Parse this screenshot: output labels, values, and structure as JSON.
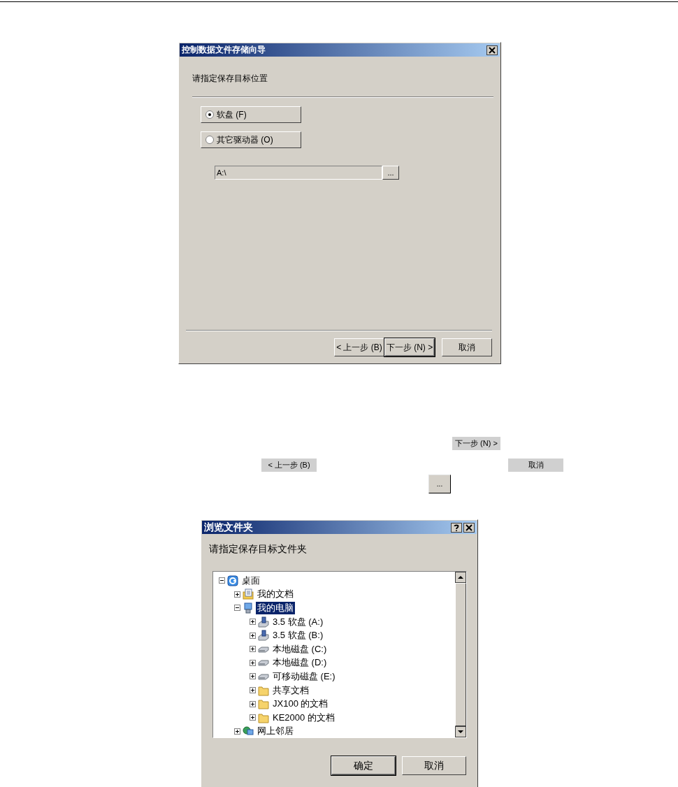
{
  "wizard": {
    "title": "控制数据文件存储向导",
    "prompt": "请指定保存目标位置",
    "options": [
      {
        "label": "软盘 (F)",
        "selected": true
      },
      {
        "label": "其它驱动器 (O)",
        "selected": false
      }
    ],
    "path": {
      "value": "A:\\",
      "disabled": true
    },
    "browse_button": "...",
    "buttons": [
      {
        "label": "< 上一步 (B)",
        "default": false
      },
      {
        "label": "下一步 (N) >",
        "default": true
      },
      {
        "label": "取消",
        "default": false
      }
    ]
  },
  "inline_buttons": [
    {
      "label": "下一步 (N) >"
    },
    {
      "label": "< 上一步 (B)"
    },
    {
      "label": "取消"
    },
    {
      "label": "..."
    }
  ],
  "browse_dialog": {
    "title": "浏览文件夹",
    "prompt": "请指定保存目标文件夹",
    "tree": [
      {
        "label": "桌面",
        "kind": "desktop",
        "expanded": true,
        "selected": false,
        "children": [
          {
            "label": "我的文档",
            "kind": "documents",
            "expanded": false,
            "selected": false
          },
          {
            "label": "我的电脑",
            "kind": "computer",
            "expanded": true,
            "selected": true,
            "children": [
              {
                "label": "3.5 软盘 (A:)",
                "kind": "floppy",
                "expanded": false,
                "selected": false
              },
              {
                "label": "3.5 软盘 (B:)",
                "kind": "floppy",
                "expanded": false,
                "selected": false
              },
              {
                "label": "本地磁盘 (C:)",
                "kind": "disk",
                "expanded": false,
                "selected": false
              },
              {
                "label": "本地磁盘 (D:)",
                "kind": "disk",
                "expanded": false,
                "selected": false
              },
              {
                "label": "可移动磁盘 (E:)",
                "kind": "disk",
                "expanded": false,
                "selected": false
              },
              {
                "label": "共享文档",
                "kind": "folder",
                "expanded": false,
                "selected": false
              },
              {
                "label": "JX100 的文档",
                "kind": "folder",
                "expanded": false,
                "selected": false
              },
              {
                "label": "KE2000 的文档",
                "kind": "folder",
                "expanded": false,
                "selected": false
              }
            ]
          },
          {
            "label": "网上邻居",
            "kind": "network",
            "expanded": false,
            "selected": false
          }
        ]
      }
    ],
    "buttons": [
      {
        "label": "确定",
        "default": true
      },
      {
        "label": "取消",
        "default": false
      }
    ]
  }
}
